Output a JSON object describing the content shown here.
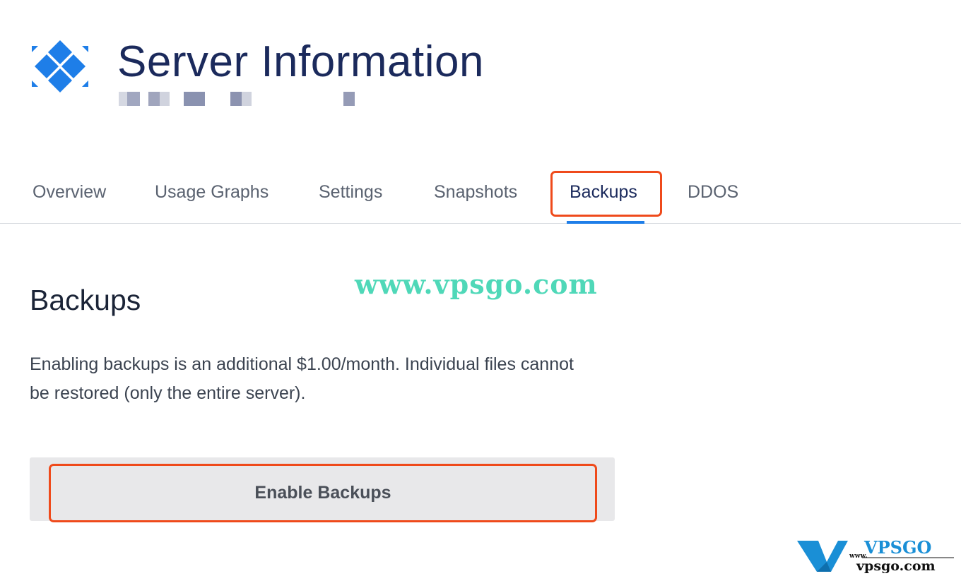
{
  "header": {
    "title": "Server Information",
    "logo_icon": "vultr-style-diamond-grid-icon",
    "brand_color": "#1e7ee8"
  },
  "tabs": [
    {
      "label": "Overview",
      "active": false
    },
    {
      "label": "Usage Graphs",
      "active": false
    },
    {
      "label": "Settings",
      "active": false
    },
    {
      "label": "Snapshots",
      "active": false
    },
    {
      "label": "Backups",
      "active": true
    },
    {
      "label": "DDOS",
      "active": false
    }
  ],
  "watermark": "www.vpsgo.com",
  "section": {
    "heading": "Backups",
    "description": "Enabling backups is an additional $1.00/month. Individual files cannot be restored (only the entire server).",
    "enable_button": "Enable Backups"
  },
  "highlight_color": "#ef4a1b",
  "corner_brand": {
    "name": "VPSGO",
    "site": "vpsgo.com",
    "prefix": "www."
  }
}
